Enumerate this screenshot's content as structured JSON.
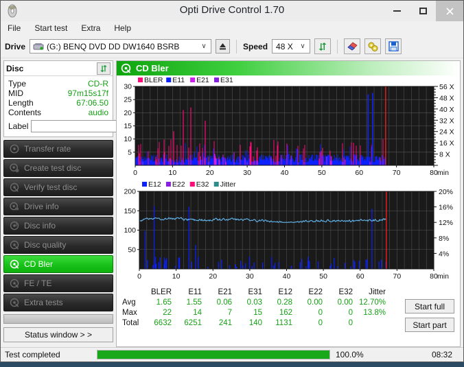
{
  "window": {
    "title": "Opti Drive Control 1.70",
    "icon": "disc-icon",
    "minimize": "–",
    "maximize": "□",
    "close": "×"
  },
  "menu": {
    "items": [
      "File",
      "Start test",
      "Extra",
      "Help"
    ]
  },
  "drivebar": {
    "drive_label": "Drive",
    "drive_value": "(G:)   BENQ DVD DD DW1640 BSRB",
    "eject_icon": "eject-icon",
    "speed_label": "Speed",
    "speed_value": "48 X",
    "refresh_icon": "refresh-icon",
    "erase_icon": "eraser-icon",
    "settings_icon": "gears-icon",
    "save_icon": "floppy-save-icon",
    "dropdown_glyph": "∨"
  },
  "disc": {
    "header": "Disc",
    "refresh_icon": "refresh-icon",
    "rows": [
      {
        "key": "Type",
        "value": "CD-R"
      },
      {
        "key": "MID",
        "value": "97m15s17f"
      },
      {
        "key": "Length",
        "value": "67:06.50"
      },
      {
        "key": "Contents",
        "value": "audio"
      }
    ],
    "label_key": "Label",
    "label_value": "",
    "label_placeholder": "",
    "cd_icon": "cd-disc-icon"
  },
  "nav": {
    "items": [
      {
        "label": "Transfer rate",
        "icon": "disc-test-icon",
        "active": false
      },
      {
        "label": "Create test disc",
        "icon": "disc-burn-icon",
        "active": false
      },
      {
        "label": "Verify test disc",
        "icon": "disc-verify-icon",
        "active": false
      },
      {
        "label": "Drive info",
        "icon": "drive-info-icon",
        "active": false
      },
      {
        "label": "Disc info",
        "icon": "disc-info-icon",
        "active": false
      },
      {
        "label": "Disc quality",
        "icon": "disc-quality-icon",
        "active": false
      },
      {
        "label": "CD Bler",
        "icon": "cd-bler-icon",
        "active": true
      },
      {
        "label": "FE / TE",
        "icon": "fe-te-icon",
        "active": false
      },
      {
        "label": "Extra tests",
        "icon": "extra-tests-icon",
        "active": false
      }
    ],
    "status_window": "Status window > >"
  },
  "panel": {
    "header": "CD Bler",
    "header_icon": "cd-bler-icon"
  },
  "actions": {
    "start_full": "Start full",
    "start_part": "Start part"
  },
  "statusbar": {
    "text": "Test completed",
    "percent": "100.0%",
    "progress": 100,
    "time": "08:32"
  },
  "stats": {
    "columns": [
      "BLER",
      "E11",
      "E21",
      "E31",
      "E12",
      "E22",
      "E32",
      "Jitter"
    ],
    "rows": [
      {
        "label": "Avg",
        "values": [
          "1.65",
          "1.55",
          "0.06",
          "0.03",
          "0.28",
          "0.00",
          "0.00",
          "12.70%"
        ]
      },
      {
        "label": "Max",
        "values": [
          "22",
          "14",
          "7",
          "15",
          "162",
          "0",
          "0",
          "13.8%"
        ]
      },
      {
        "label": "Total",
        "values": [
          "6632",
          "6251",
          "241",
          "140",
          "1131",
          "0",
          "0",
          ""
        ]
      }
    ]
  },
  "chart_data": [
    {
      "type": "bar",
      "id": "bler-chart",
      "title": "CD Bler",
      "xlabel": "min",
      "ylabel": "",
      "xlim": [
        0,
        80
      ],
      "ylim": [
        0,
        30
      ],
      "yticks": [
        5,
        10,
        15,
        20,
        25,
        30
      ],
      "xticks": [
        0,
        10,
        20,
        30,
        40,
        50,
        60,
        70,
        80
      ],
      "right_axis_label": "X",
      "right_ticks": [
        "8 X",
        "16 X",
        "24 X",
        "32 X",
        "40 X",
        "48 X",
        "56 X"
      ],
      "right_lim": [
        0,
        56
      ],
      "grid": true,
      "background": "#1a1a1a",
      "legend_position": "top-left",
      "legend": [
        {
          "name": "BLER",
          "color": "#ff0a78"
        },
        {
          "name": "E11",
          "color": "#0b22ff"
        },
        {
          "name": "E21",
          "color": "#cc22ee"
        },
        {
          "name": "E31",
          "color": "#8a1fe0"
        }
      ],
      "data_end_min": 67.1,
      "speed_line_color": "#ff2020",
      "series": [
        {
          "name": "E11",
          "color": "#0b22ff",
          "avg": 1.55,
          "max": 14,
          "total": 6251
        },
        {
          "name": "BLER",
          "color": "#ff0a78",
          "avg": 1.65,
          "max": 22,
          "total": 6632
        },
        {
          "name": "E21",
          "color": "#cc22ee",
          "avg": 0.06,
          "max": 7,
          "total": 241
        },
        {
          "name": "E31",
          "color": "#8a1fe0",
          "avg": 0.03,
          "max": 15,
          "total": 140
        }
      ],
      "notable_peaks": [
        {
          "x": 13.2,
          "y": 21,
          "series": "BLER"
        },
        {
          "x": 14.8,
          "y": 22,
          "series": "BLER"
        },
        {
          "x": 19.0,
          "y": 17,
          "series": "BLER"
        },
        {
          "x": 10.6,
          "y": 13,
          "series": "BLER"
        },
        {
          "x": 63.5,
          "y": 31,
          "series": "E11-speed-region"
        }
      ]
    },
    {
      "type": "line",
      "id": "e12-jitter-chart",
      "xlabel": "min",
      "xlim": [
        0,
        80
      ],
      "ylim": [
        0,
        200
      ],
      "yticks": [
        50,
        100,
        150,
        200
      ],
      "xticks": [
        0,
        10,
        20,
        30,
        40,
        50,
        60,
        70,
        80
      ],
      "right_ticks": [
        "4%",
        "8%",
        "12%",
        "16%",
        "20%"
      ],
      "right_lim": [
        0,
        20
      ],
      "grid": true,
      "background": "#1a1a1a",
      "legend_position": "top-left",
      "legend": [
        {
          "name": "E12",
          "color": "#0b22ff"
        },
        {
          "name": "E22",
          "color": "#8a1fe0"
        },
        {
          "name": "E32",
          "color": "#ff0a78"
        },
        {
          "name": "Jitter",
          "color": "#2e8c8c"
        }
      ],
      "data_end_min": 67.1,
      "speed_line_color": "#ff2020",
      "jitter": {
        "name": "Jitter",
        "color": "#63b8f0",
        "avg_percent": 12.7,
        "max_percent": 13.8,
        "value_range": [
          120,
          137
        ]
      },
      "series": [
        {
          "name": "E12",
          "color": "#0b22ff",
          "avg": 0.28,
          "max": 162,
          "total": 1131
        },
        {
          "name": "E22",
          "color": "#8a1fe0",
          "avg": 0.0,
          "max": 0,
          "total": 0
        },
        {
          "name": "E32",
          "color": "#ff0a78",
          "avg": 0.0,
          "max": 0,
          "total": 0
        }
      ],
      "notable_peaks": [
        {
          "x": 1.6,
          "y": 98,
          "series": "E12"
        },
        {
          "x": 4.0,
          "y": 162,
          "series": "E12"
        },
        {
          "x": 13.5,
          "y": 160,
          "series": "E12"
        },
        {
          "x": 15.3,
          "y": 62,
          "series": "E12"
        },
        {
          "x": 63.2,
          "y": 155,
          "series": "E12"
        }
      ]
    }
  ]
}
